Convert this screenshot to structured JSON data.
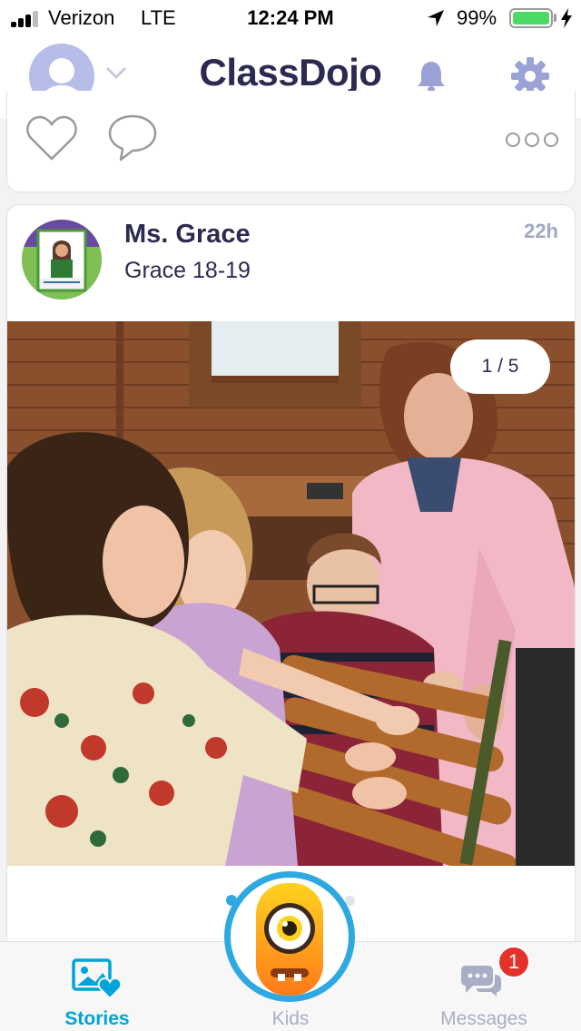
{
  "status_bar": {
    "carrier": "Verizon",
    "network": "LTE",
    "time": "12:24 PM",
    "battery_percent": "99%",
    "signal_bars": 3,
    "icons": [
      "signal-icon",
      "location-arrow-icon",
      "battery-icon",
      "charging-bolt-icon"
    ]
  },
  "header": {
    "title": "ClassDojo",
    "icons": [
      "profile-avatar-icon",
      "chevron-down-icon",
      "bell-icon",
      "gear-icon"
    ]
  },
  "previous_post": {
    "icons": [
      "heart-icon",
      "comment-icon",
      "more-icon"
    ]
  },
  "post": {
    "author": "Ms. Grace",
    "class_name": "Grace 18-19",
    "time_ago": "22h",
    "photo_counter": "1 / 5"
  },
  "tab_bar": {
    "tabs": [
      {
        "label": "Stories",
        "icon": "stories-icon",
        "active": true
      },
      {
        "label": "Kids",
        "icon": "kids-monster-icon",
        "active": false
      },
      {
        "label": "Messages",
        "icon": "messages-icon",
        "active": false
      }
    ],
    "messages_badge": "1"
  },
  "colors": {
    "brand_text": "#2c2a50",
    "active_tab": "#00a4d9",
    "inactive_tab": "#a7aec5",
    "badge": "#e4322b",
    "battery": "#4cd964"
  }
}
